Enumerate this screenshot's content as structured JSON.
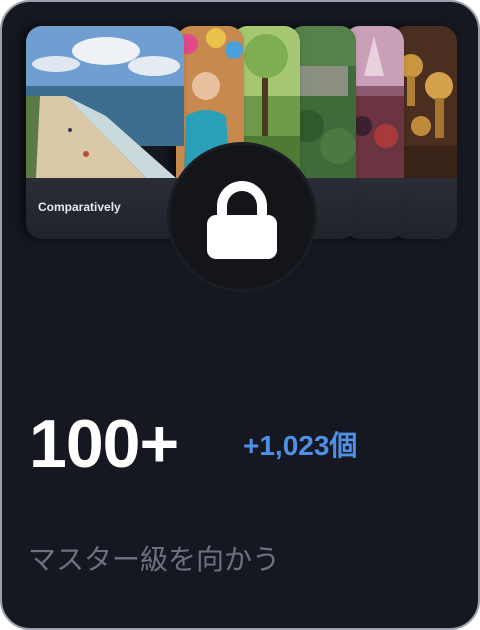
{
  "card": {
    "panel_label": "Comparatively",
    "count": "100+",
    "delta": "+1,023個",
    "subtitle": "マスター級を向かう"
  },
  "icons": {
    "lock": "lock-icon"
  },
  "colors": {
    "card_background": "#161821",
    "accent": "#4f8fe6",
    "subtitle": "#6c7180"
  },
  "images": [
    "beach-shoreline-painting",
    "elderly-man-portrait",
    "forest-park-scene",
    "crowd-in-park-aerial",
    "fantasy-castle-crowd",
    "golden-trophies"
  ]
}
